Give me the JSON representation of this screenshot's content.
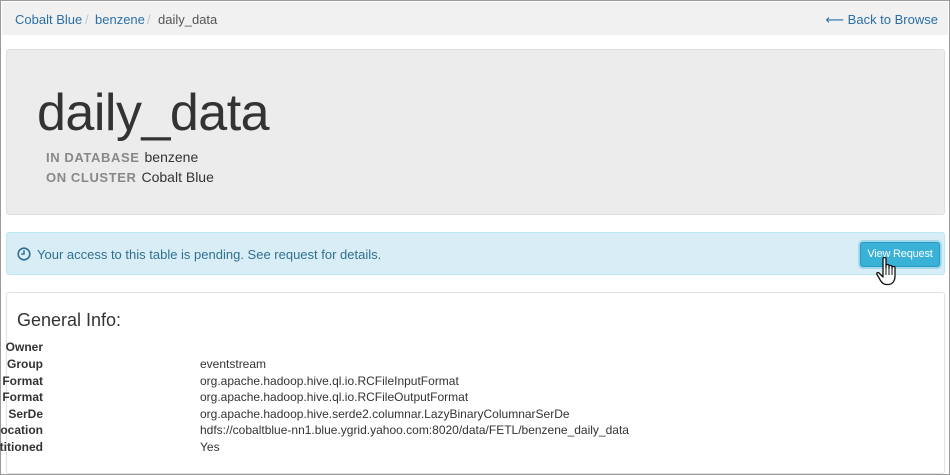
{
  "breadcrumb": {
    "items": [
      {
        "label": "Cobalt Blue"
      },
      {
        "label": "benzene"
      }
    ],
    "separator": "/",
    "current": "daily_data",
    "back_label": "⟵ Back to Browse"
  },
  "header": {
    "title": "daily_data",
    "database_label": "IN DATABASE",
    "database_value": "benzene",
    "cluster_label": "ON CLUSTER",
    "cluster_value": "Cobalt Blue"
  },
  "alert": {
    "icon": "clock-icon",
    "message": "Your access to this table is pending. See request for details.",
    "button_label": "View Request"
  },
  "general_info": {
    "title": "General Info:",
    "rows": [
      {
        "key": "Owner",
        "value": ""
      },
      {
        "key": "Group",
        "value": "eventstream"
      },
      {
        "key": "Input Format",
        "value": "org.apache.hadoop.hive.ql.io.RCFileInputFormat"
      },
      {
        "key": "Output Format",
        "value": "org.apache.hadoop.hive.ql.io.RCFileOutputFormat"
      },
      {
        "key": "SerDe",
        "value": "org.apache.hadoop.hive.serde2.columnar.LazyBinaryColumnarSerDe"
      },
      {
        "key": "Location",
        "value": "hdfs://cobaltblue-nn1.blue.ygrid.yahoo.com:8020/data/FETL/benzene_daily_data"
      },
      {
        "key": "Partitioned",
        "value": "Yes"
      }
    ]
  },
  "colors": {
    "link": "#2a6fa8",
    "alert_bg": "#d9edf7",
    "alert_text": "#31708f",
    "button": "#3ab1d6"
  }
}
